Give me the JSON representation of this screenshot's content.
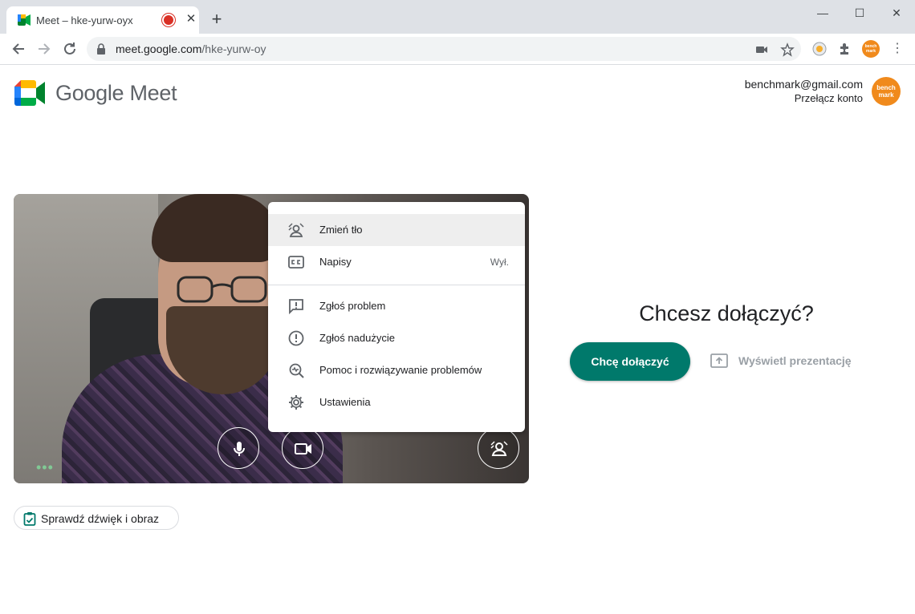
{
  "browser": {
    "tab_title": "Meet – hke-yurw-oyx",
    "new_tab": "+",
    "url_host": "meet.google.com",
    "url_path": "/hke-yurw-oy",
    "window_controls": [
      "minimize-icon",
      "maximize-icon",
      "close-icon"
    ]
  },
  "header": {
    "brand": "Google Meet",
    "email": "benchmark@gmail.com",
    "switch_account": "Przełącz konto",
    "avatar_text": "bench mark"
  },
  "menu": {
    "items": [
      {
        "label": "Zmień tło",
        "icon": "background-icon"
      },
      {
        "label": "Napisy",
        "value": "Wył.",
        "icon": "captions-icon"
      },
      {
        "label": "Zgłoś problem",
        "icon": "feedback-icon"
      },
      {
        "label": "Zgłoś nadużycie",
        "icon": "report-icon"
      },
      {
        "label": "Pomoc i rozwiązywanie problemów",
        "icon": "help-icon"
      },
      {
        "label": "Ustawienia",
        "icon": "settings-icon"
      }
    ]
  },
  "preview": {
    "more_dots": "•••"
  },
  "join": {
    "title": "Chcesz dołączyć?",
    "join_label": "Chcę dołączyć",
    "present_label": "Wyświetl prezentację"
  },
  "check": {
    "label": "Sprawdź dźwięk i obraz"
  },
  "colors": {
    "accent": "#00796b",
    "avatar": "#f08a1c",
    "recording": "#d93025"
  }
}
